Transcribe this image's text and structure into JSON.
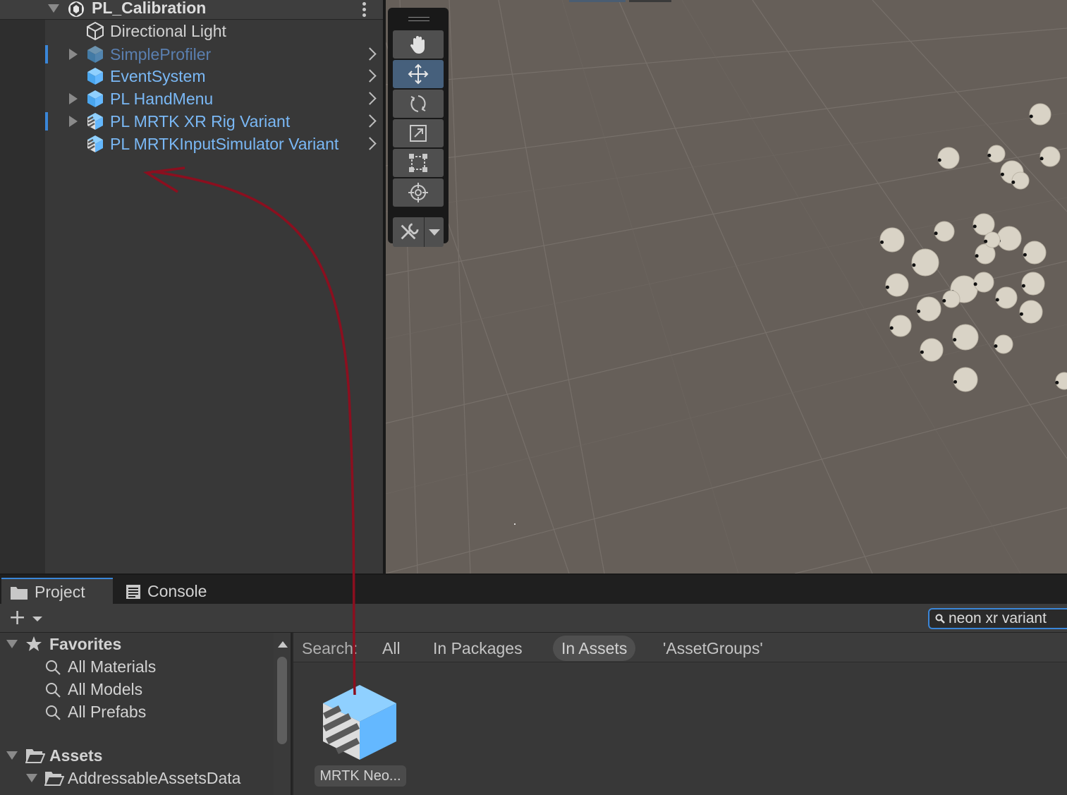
{
  "hierarchy": {
    "scene_name": "PL_Calibration",
    "items": [
      {
        "label": "Directional Light",
        "icon": "light-object-icon",
        "has_children": false,
        "color": "#dcdcdc",
        "modified": false
      },
      {
        "label": "SimpleProfiler",
        "icon": "prefab-cube-icon",
        "has_children": true,
        "color": "#5a7fb0",
        "modified": true
      },
      {
        "label": "EventSystem",
        "icon": "prefab-cube-icon",
        "has_children": false,
        "color": "#7ab8f5",
        "modified": false
      },
      {
        "label": "PL HandMenu",
        "icon": "prefab-cube-icon",
        "has_children": true,
        "color": "#7ab8f5",
        "modified": false
      },
      {
        "label": "PL MRTK XR Rig Variant",
        "icon": "prefab-variant-icon",
        "has_children": true,
        "color": "#7ab8f5",
        "modified": true
      },
      {
        "label": "PL MRTKInputSimulator Variant",
        "icon": "prefab-variant-icon",
        "has_children": false,
        "color": "#7ab8f5",
        "modified": false
      }
    ]
  },
  "scene_tools": [
    "hand-tool-icon",
    "move-tool-icon",
    "rotate-tool-icon",
    "scale-tool-icon",
    "rect-tool-icon",
    "transform-tool-icon",
    "custom-tools-icon"
  ],
  "active_tool": "move-tool-icon",
  "bottom_tabs": {
    "project": "Project",
    "console": "Console"
  },
  "search": {
    "value": "neon xr variant"
  },
  "favorites": {
    "title": "Favorites",
    "items": [
      "All Materials",
      "All Models",
      "All Prefabs"
    ]
  },
  "assets": {
    "title": "Assets",
    "child": "AddressableAssetsData"
  },
  "filters": {
    "label": "Search:",
    "options": [
      "All",
      "In Packages",
      "In Assets",
      "'AssetGroups'"
    ],
    "selected": "In Assets"
  },
  "results": [
    {
      "label": "MRTK Neo...",
      "icon": "prefab-variant-icon"
    }
  ],
  "colors": {
    "accent": "#3a86d8",
    "prefab_blue": "#7ab8f5",
    "annotation_arrow": "#8b0f1f"
  }
}
